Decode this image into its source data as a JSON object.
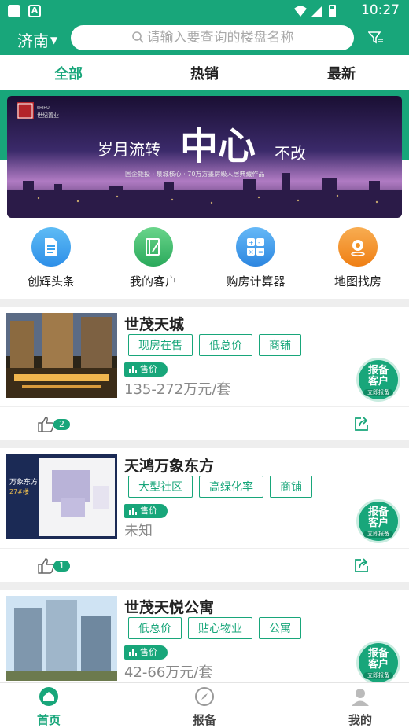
{
  "statusbar": {
    "time": "10:27"
  },
  "header": {
    "city": "济南",
    "search_placeholder": "请输入要查询的楼盘名称"
  },
  "tabs": [
    {
      "label": "全部",
      "active": true
    },
    {
      "label": "热销",
      "active": false
    },
    {
      "label": "最新",
      "active": false
    }
  ],
  "banner": {
    "brand": "世纪置业",
    "slogan_left": "岁月流转",
    "slogan_main": "中心",
    "slogan_right": "不改",
    "subtitle": "国企钜投 · 泉城核心 · 70万方墨房级人居典藏作品"
  },
  "quick_links": [
    {
      "label": "创辉头条",
      "icon": "document-icon",
      "color": "#3aa2ee"
    },
    {
      "label": "我的客户",
      "icon": "notebook-icon",
      "color": "#35b96a"
    },
    {
      "label": "购房计算器",
      "icon": "calculator-icon",
      "color": "#3d9df0"
    },
    {
      "label": "地图找房",
      "icon": "map-pin-icon",
      "color": "#f29324"
    }
  ],
  "listings": [
    {
      "name": "世茂天城",
      "tags": [
        "现房在售",
        "低总价",
        "商铺"
      ],
      "price_badge": "售价",
      "price": "135-272万元/套",
      "likes": "2",
      "report_label_1": "报备",
      "report_label_2": "客户",
      "report_sub": "立即报备"
    },
    {
      "name": "天鸿万象东方",
      "tags": [
        "大型社区",
        "高绿化率",
        "商铺"
      ],
      "price_badge": "售价",
      "price": "未知",
      "likes": "1",
      "report_label_1": "报备",
      "report_label_2": "客户",
      "report_sub": "立即报备",
      "thumb_text": "万象东方",
      "thumb_sub": "27#楼"
    },
    {
      "name": "世茂天悦公寓",
      "tags": [
        "低总价",
        "贴心物业",
        "公寓"
      ],
      "price_badge": "售价",
      "price": "42-66万元/套",
      "report_label_1": "报备",
      "report_label_2": "客户",
      "report_sub": "立即报备"
    }
  ],
  "bottom_nav": [
    {
      "label": "首页",
      "active": true
    },
    {
      "label": "报备",
      "active": false
    },
    {
      "label": "我的",
      "active": false
    }
  ],
  "colors": {
    "primary": "#18a67a",
    "divider": "#eeeeee"
  }
}
